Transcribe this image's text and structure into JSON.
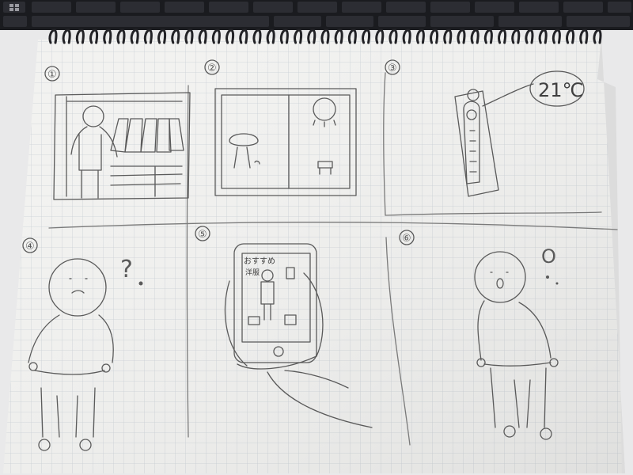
{
  "photo": {
    "subject": "hand-drawn six-panel storyboard on a spiral grid notebook",
    "colors": {
      "desk": "#e9e9ea",
      "keyboard": "#1a1b1f",
      "paper": "#f2f2f0",
      "grid": "#c9d0d6",
      "pencil": "#5a5a5a",
      "spiral": "#222226"
    }
  },
  "panels": [
    {
      "number": "①",
      "scene": "person standing at an open wardrobe with hanging clothes and drawers"
    },
    {
      "number": "②",
      "scene": "window with a tree on one side and the sun over a bench on the other"
    },
    {
      "number": "③",
      "scene": "wall thermometer",
      "speech_text": "21℃"
    },
    {
      "number": "④",
      "scene": "person wondering",
      "thought_mark": "?"
    },
    {
      "number": "⑤",
      "scene": "hand holding a smartphone showing an outfit app",
      "phone_header": "おすすめ",
      "phone_sub": "洋服"
    },
    {
      "number": "⑥",
      "scene": "surprised person",
      "thought_mark": "O"
    }
  ]
}
